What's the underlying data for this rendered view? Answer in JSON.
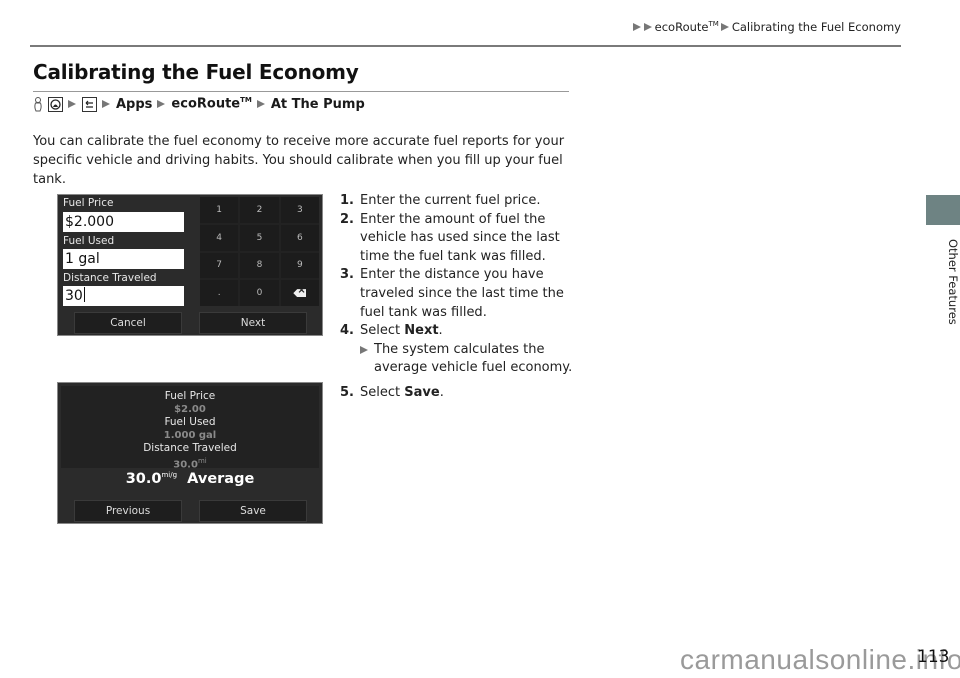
{
  "header": {
    "breadcrumb": [
      "ecoRoute",
      "Calibrating the Fuel Economy"
    ],
    "tm": "TM"
  },
  "title": "Calibrating the Fuel Economy",
  "nav_path": {
    "icons": [
      "voice-icon",
      "home-icon",
      "back-icon"
    ],
    "items": [
      "Apps",
      "ecoRoute",
      "At The Pump"
    ],
    "tm": "TM"
  },
  "intro": "You can calibrate the fuel economy to receive more accurate fuel reports for your specific vehicle and driving habits. You should calibrate when you fill up your fuel tank.",
  "screen1": {
    "fields": [
      {
        "label": "Fuel Price",
        "value": "$2.000"
      },
      {
        "label": "Fuel Used",
        "value": "1 gal"
      },
      {
        "label": "Distance Traveled",
        "value": "30"
      }
    ],
    "keypad": [
      "1",
      "2",
      "3",
      "4",
      "5",
      "6",
      "7",
      "8",
      "9",
      ".",
      "0",
      "backspace"
    ],
    "buttons": {
      "left": "Cancel",
      "right": "Next"
    }
  },
  "screen2": {
    "summary": [
      {
        "label": "Fuel Price",
        "value": "$2.00"
      },
      {
        "label": "Fuel Used",
        "value": "1.000 gal"
      },
      {
        "label": "Distance Traveled",
        "value": "30.0",
        "unit": "mi"
      }
    ],
    "average": {
      "value": "30.0",
      "unit": "mi/g",
      "label": "Average"
    },
    "buttons": {
      "left": "Previous",
      "right": "Save"
    }
  },
  "steps": [
    {
      "num": "1.",
      "text": "Enter the current fuel price."
    },
    {
      "num": "2.",
      "text": "Enter the amount of fuel the vehicle has used since the last time the fuel tank was filled."
    },
    {
      "num": "3.",
      "text": "Enter the distance you have traveled since the last time the fuel tank was filled."
    },
    {
      "num": "4.",
      "prefix": "Select ",
      "keyword": "Next",
      "suffix": ".",
      "sub": "The system calculates the average vehicle fuel economy."
    },
    {
      "num": "5.",
      "prefix": "Select ",
      "keyword": "Save",
      "suffix": "."
    }
  ],
  "side_tab": {
    "label": "Other Features",
    "color": "#6e8383"
  },
  "page_number": "113",
  "watermark": "carmanualsonline.info"
}
